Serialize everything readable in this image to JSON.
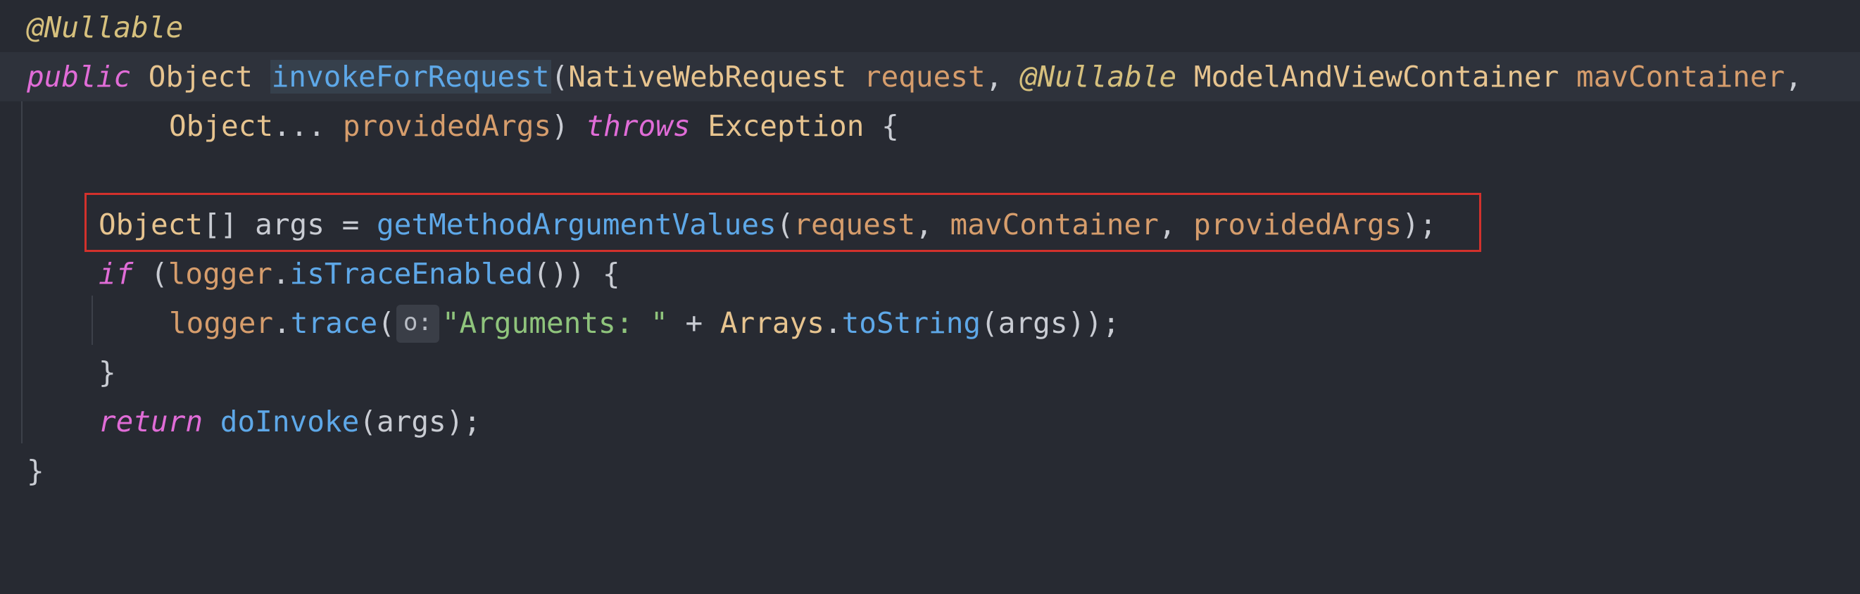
{
  "editor": {
    "lines": [
      {
        "tokens": [
          {
            "t": "@Nullable",
            "c": "ann"
          }
        ]
      },
      {
        "tokens": [
          {
            "t": "public",
            "c": "kw"
          },
          {
            "t": " ",
            "c": "plain"
          },
          {
            "t": "Object",
            "c": "type"
          },
          {
            "t": " ",
            "c": "plain"
          },
          {
            "t": "invokeForRequest",
            "c": "method-decl"
          },
          {
            "t": "(",
            "c": "plain"
          },
          {
            "t": "NativeWebRequest",
            "c": "type"
          },
          {
            "t": " ",
            "c": "plain"
          },
          {
            "t": "request",
            "c": "param"
          },
          {
            "t": ", ",
            "c": "plain"
          },
          {
            "t": "@Nullable",
            "c": "ann"
          },
          {
            "t": " ",
            "c": "plain"
          },
          {
            "t": "ModelAndViewContainer",
            "c": "type"
          },
          {
            "t": " ",
            "c": "plain"
          },
          {
            "t": "mavContainer",
            "c": "param"
          },
          {
            "t": ",",
            "c": "plain"
          }
        ]
      },
      {
        "tokens": [
          {
            "t": "Object",
            "c": "type"
          },
          {
            "t": "... ",
            "c": "plain"
          },
          {
            "t": "providedArgs",
            "c": "param"
          },
          {
            "t": ") ",
            "c": "plain"
          },
          {
            "t": "throws",
            "c": "kw"
          },
          {
            "t": " ",
            "c": "plain"
          },
          {
            "t": "Exception",
            "c": "type"
          },
          {
            "t": " {",
            "c": "plain"
          }
        ]
      },
      {
        "tokens": []
      },
      {
        "tokens": [
          {
            "t": "Object",
            "c": "type"
          },
          {
            "t": "[] args = ",
            "c": "plain"
          },
          {
            "t": "getMethodArgumentValues",
            "c": "fn"
          },
          {
            "t": "(",
            "c": "plain"
          },
          {
            "t": "request",
            "c": "param"
          },
          {
            "t": ", ",
            "c": "plain"
          },
          {
            "t": "mavContainer",
            "c": "param"
          },
          {
            "t": ", ",
            "c": "plain"
          },
          {
            "t": "providedArgs",
            "c": "param"
          },
          {
            "t": ");",
            "c": "plain"
          }
        ]
      },
      {
        "tokens": [
          {
            "t": "if",
            "c": "kw"
          },
          {
            "t": " (",
            "c": "plain"
          },
          {
            "t": "logger",
            "c": "param"
          },
          {
            "t": ".",
            "c": "plain"
          },
          {
            "t": "isTraceEnabled",
            "c": "fn"
          },
          {
            "t": "()) {",
            "c": "plain"
          }
        ]
      },
      {
        "tokens": [
          {
            "t": "logger",
            "c": "param"
          },
          {
            "t": ".",
            "c": "plain"
          },
          {
            "t": "trace",
            "c": "fn"
          },
          {
            "t": "(",
            "c": "plain"
          },
          {
            "t": "o:",
            "c": "hint"
          },
          {
            "t": "\"Arguments: \"",
            "c": "str"
          },
          {
            "t": " + ",
            "c": "plain"
          },
          {
            "t": "Arrays",
            "c": "type"
          },
          {
            "t": ".",
            "c": "plain"
          },
          {
            "t": "toString",
            "c": "fn"
          },
          {
            "t": "(args));",
            "c": "plain"
          }
        ]
      },
      {
        "tokens": [
          {
            "t": "}",
            "c": "plain"
          }
        ]
      },
      {
        "tokens": [
          {
            "t": "return",
            "c": "kw"
          },
          {
            "t": " ",
            "c": "plain"
          },
          {
            "t": "doInvoke",
            "c": "fn"
          },
          {
            "t": "(args);",
            "c": "plain"
          }
        ]
      },
      {
        "tokens": [
          {
            "t": "}",
            "c": "plain"
          }
        ]
      }
    ]
  },
  "colors": {
    "background": "#272a32",
    "keyword": "#e06cd7",
    "annotation": "#d6c07d",
    "type": "#e7c48f",
    "function": "#5ea8e8",
    "parameter": "#d69d6c",
    "string": "#8fc47c",
    "selection_border": "#d2312c"
  }
}
